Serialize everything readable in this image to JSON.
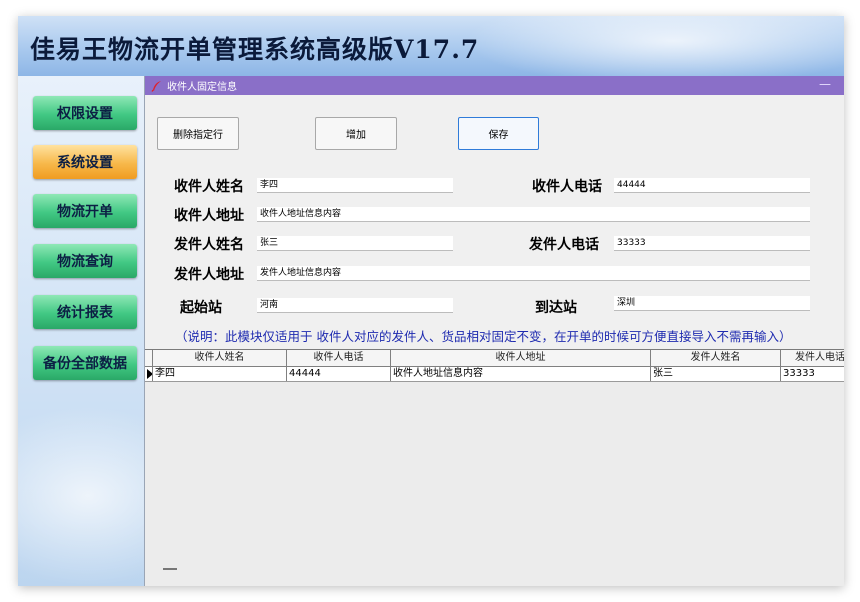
{
  "app": {
    "title": "佳易王物流开单管理系统高级版V17.7"
  },
  "nav": {
    "items": [
      {
        "label": "权限设置"
      },
      {
        "label": "系统设置"
      },
      {
        "label": "物流开单"
      },
      {
        "label": "物流查询"
      },
      {
        "label": "统计报表"
      },
      {
        "label": "备份全部数据"
      }
    ]
  },
  "window": {
    "title": "收件人固定信息",
    "minimize_glyph": "—",
    "icon": "feather-icon"
  },
  "toolbar": {
    "delete_label": "删除指定行",
    "add_label": "增加",
    "save_label": "保存"
  },
  "form": {
    "receiver_name_label": "收件人姓名",
    "receiver_name_value": "李四",
    "receiver_phone_label": "收件人电话",
    "receiver_phone_value": "44444",
    "receiver_address_label": "收件人地址",
    "receiver_address_value": "收件人地址信息内容",
    "sender_name_label": "发件人姓名",
    "sender_name_value": "张三",
    "sender_phone_label": "发件人电话",
    "sender_phone_value": "33333",
    "sender_address_label": "发件人地址",
    "sender_address_value": "发件人地址信息内容",
    "origin_label": "起始站",
    "origin_value": "河南",
    "destination_label": "到达站",
    "destination_value": "深圳"
  },
  "note": "（说明：此模块仅适用于 收件人对应的发件人、货品相对固定不变，在开单的时候可方便直接导入不需再输入）",
  "grid": {
    "columns": [
      "收件人姓名",
      "收件人电话",
      "收件人地址",
      "发件人姓名",
      "发件人电话"
    ],
    "rows": [
      [
        "李四",
        "44444",
        "收件人地址信息内容",
        "张三",
        "33333"
      ]
    ]
  },
  "colors": {
    "nav_green": "#41c883",
    "nav_orange_selected": "#f7b84a",
    "titlebar": "#8a6fc8",
    "note_text": "#1f2bb0"
  }
}
